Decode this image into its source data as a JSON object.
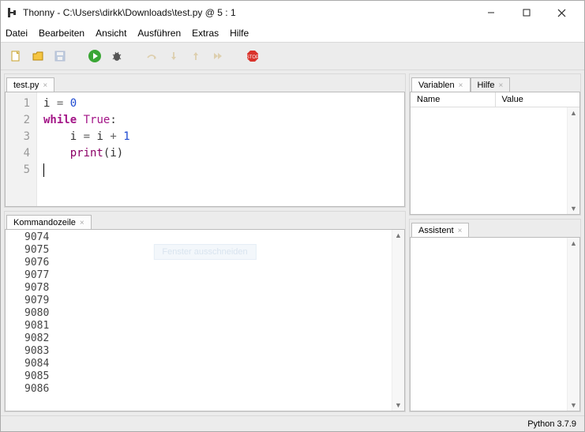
{
  "title": "Thonny  -  C:\\Users\\dirkk\\Downloads\\test.py  @  5 : 1",
  "menu": [
    "Datei",
    "Bearbeiten",
    "Ansicht",
    "Ausführen",
    "Extras",
    "Hilfe"
  ],
  "toolbar_icons": {
    "new": "new-file-icon",
    "open": "open-folder-icon",
    "save": "save-icon",
    "run": "run-icon",
    "debug": "debug-icon",
    "step_over": "step-over-icon",
    "step_into": "step-into-icon",
    "step_out": "step-out-icon",
    "resume": "resume-icon",
    "stop": "stop-icon"
  },
  "editor": {
    "tab": "test.py",
    "lines": [
      "1",
      "2",
      "3",
      "4",
      "5"
    ],
    "code": {
      "l1_a": "i ",
      "l1_eq": "=",
      "l1_b": " ",
      "l1_num": "0",
      "l2_kw1": "while",
      "l2_sp": " ",
      "l2_kw2": "True",
      "l2_c": ":",
      "l3_ind": "    i ",
      "l3_eq": "=",
      "l3_mid": " i ",
      "l3_plus": "+",
      "l3_sp": " ",
      "l3_num": "1",
      "l4_ind": "    ",
      "l4_func": "print",
      "l4_open": "(",
      "l4_arg": "i",
      "l4_close": ")"
    }
  },
  "shell": {
    "tab": "Kommandozeile",
    "lines": [
      "9074",
      "9075",
      "9076",
      "9077",
      "9078",
      "9079",
      "9080",
      "9081",
      "9082",
      "9083",
      "9084",
      "9085",
      "9086"
    ],
    "ghost_text": "Fenster ausschneiden"
  },
  "variables": {
    "tab1": "Variablen",
    "tab2": "Hilfe",
    "col1": "Name",
    "col2": "Value"
  },
  "assistant": {
    "tab": "Assistent"
  },
  "status": "Python 3.7.9"
}
